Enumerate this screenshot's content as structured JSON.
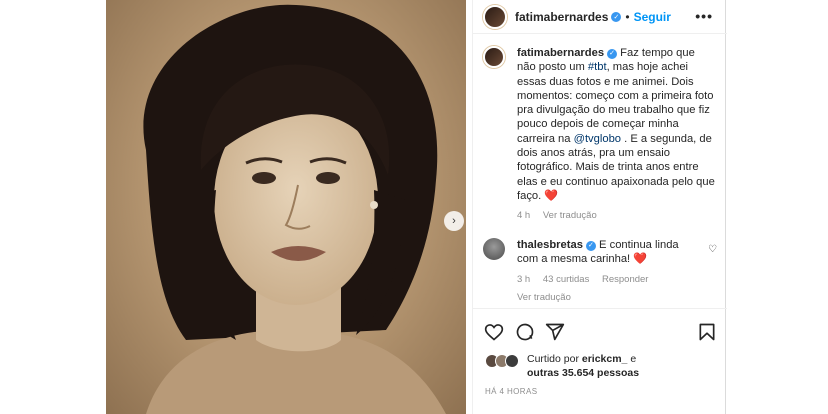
{
  "post": {
    "author": "fatimabernardes",
    "follow_label": "Seguir",
    "separator": "•",
    "more_label": "•••",
    "next_label": "›",
    "verified_mark": "✓"
  },
  "caption": {
    "username": "fatimabernardes",
    "text_1": " Faz tempo que não posto um ",
    "hashtag": "#tbt",
    "text_2": ", mas hoje achei essas duas fotos e me animei. Dois momentos: começo com a primeira foto pra divulgação do meu trabalho que fiz pouco depois de começar minha carreira na ",
    "mention": "@tvglobo",
    "text_3": " . E a segunda, de dois anos atrás, pra um ensaio fotográfico. Mais de trinta anos entre elas e eu continuo apaixonada pelo que faço. ",
    "emoji": "❤️",
    "time": "4 h",
    "translate": "Ver tradução"
  },
  "comment": {
    "username": "thalesbretas",
    "text": " E continua linda com a mesma carinha! ",
    "emoji": "❤️",
    "time": "3 h",
    "likes": "43 curtidas",
    "reply": "Responder",
    "translate": "Ver tradução",
    "like_icon": "♡"
  },
  "likes": {
    "prefix": "Curtido por ",
    "user": "erickcm_",
    "middle": " e ",
    "others": "outras 35.654 pessoas"
  },
  "timestamp": "HÁ 4 HORAS",
  "icons": [
    "heart-icon",
    "comment-icon",
    "share-icon",
    "bookmark-icon"
  ],
  "colors": {
    "follow": "#0095f6",
    "link": "#00376b",
    "verified": "#3897f0",
    "muted": "#8e8e8e"
  }
}
